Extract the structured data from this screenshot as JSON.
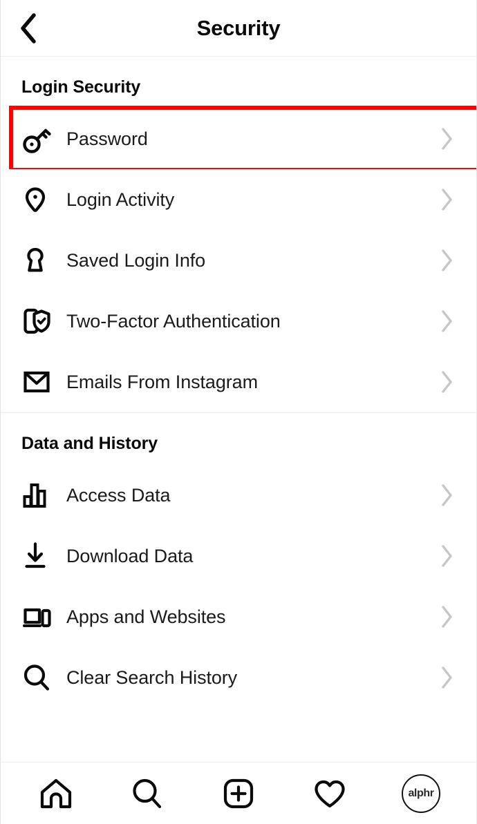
{
  "header": {
    "title": "Security",
    "back_icon": "chevron-left-icon"
  },
  "colors": {
    "highlight": "#fc0404",
    "text": "#1b1b1b",
    "chevron": "#c7c7c7",
    "divider": "#eceff1"
  },
  "sections": [
    {
      "title": "Login Security",
      "rows": [
        {
          "label": "Password",
          "icon": "key-icon",
          "chevron": "chevron-right-icon",
          "highlighted": true
        },
        {
          "label": "Login Activity",
          "icon": "location-pin-icon",
          "chevron": "chevron-right-icon",
          "highlighted": false
        },
        {
          "label": "Saved Login Info",
          "icon": "keyhole-icon",
          "chevron": "chevron-right-icon",
          "highlighted": false
        },
        {
          "label": "Two-Factor Authentication",
          "icon": "phone-shield-check-icon",
          "chevron": "chevron-right-icon",
          "highlighted": false
        },
        {
          "label": "Emails From Instagram",
          "icon": "envelope-icon",
          "chevron": "chevron-right-icon",
          "highlighted": false
        }
      ]
    },
    {
      "title": "Data and History",
      "rows": [
        {
          "label": "Access Data",
          "icon": "bar-chart-icon",
          "chevron": "chevron-right-icon",
          "highlighted": false
        },
        {
          "label": "Download Data",
          "icon": "download-arrow-icon",
          "chevron": "chevron-right-icon",
          "highlighted": false
        },
        {
          "label": "Apps and Websites",
          "icon": "devices-icon",
          "chevron": "chevron-right-icon",
          "highlighted": false
        },
        {
          "label": "Clear Search History",
          "icon": "magnifier-icon",
          "chevron": "chevron-right-icon",
          "highlighted": false
        }
      ]
    }
  ],
  "tabbar": {
    "items": [
      {
        "name": "home",
        "icon": "home-icon"
      },
      {
        "name": "search",
        "icon": "magnifier-icon"
      },
      {
        "name": "create",
        "icon": "plus-square-icon"
      },
      {
        "name": "activity",
        "icon": "heart-icon"
      },
      {
        "name": "profile",
        "icon": "avatar-icon",
        "avatar_label": "alphr"
      }
    ]
  }
}
